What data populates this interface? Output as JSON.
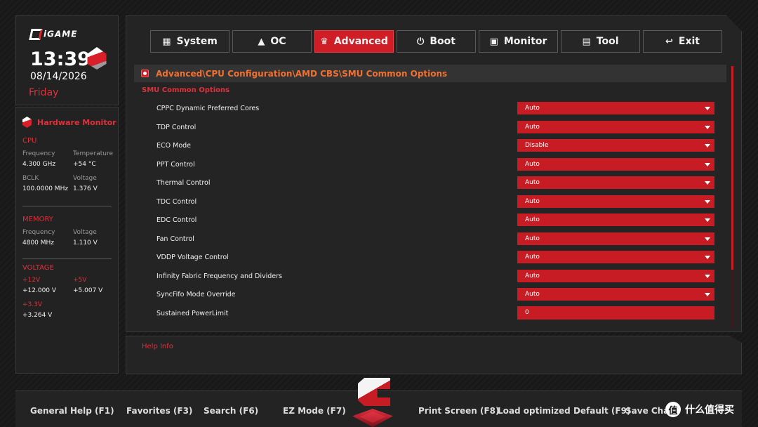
{
  "brand": {
    "logo_text": "iGAME"
  },
  "clock": {
    "time": "13:39",
    "date": "08/14/2026",
    "day": "Friday"
  },
  "hw": {
    "title": "Hardware Monitor",
    "cpu": {
      "section": "CPU",
      "freq_label": "Frequency",
      "freq_value": "4.300 GHz",
      "temp_label": "Temperature",
      "temp_value": "+54 °C",
      "bclk_label": "BCLK",
      "bclk_value": "100.0000 MHz",
      "volt_label": "Voltage",
      "volt_value": "1.376 V"
    },
    "memory": {
      "section": "MEMORY",
      "freq_label": "Frequency",
      "freq_value": "4800 MHz",
      "volt_label": "Voltage",
      "volt_value": "1.110 V"
    },
    "voltage": {
      "section": "VOLTAGE",
      "v12_label": "+12V",
      "v12_value": "+12.000 V",
      "v5_label": "+5V",
      "v5_value": "+5.007 V",
      "v33_label": "+3.3V",
      "v33_value": "+3.264 V"
    }
  },
  "tabs": [
    {
      "label": "System",
      "icon": "grid-icon"
    },
    {
      "label": "OC",
      "icon": "rocket-icon"
    },
    {
      "label": "Advanced",
      "icon": "crown-icon",
      "active": true
    },
    {
      "label": "Boot",
      "icon": "power-icon"
    },
    {
      "label": "Monitor",
      "icon": "monitor-icon"
    },
    {
      "label": "Tool",
      "icon": "toolbox-icon"
    },
    {
      "label": "Exit",
      "icon": "back-arrow-icon"
    }
  ],
  "breadcrumb": "Advanced\\CPU Configuration\\AMD CBS\\SMU Common Options",
  "section_title": "SMU Common Options",
  "options": [
    {
      "label": "CPPC Dynamic Preferred Cores",
      "value": "Auto"
    },
    {
      "label": "TDP Control",
      "value": "Auto"
    },
    {
      "label": "ECO Mode",
      "value": "Disable"
    },
    {
      "label": "PPT Control",
      "value": "Auto"
    },
    {
      "label": "Thermal Control",
      "value": "Auto"
    },
    {
      "label": "TDC Control",
      "value": "Auto"
    },
    {
      "label": "EDC Control",
      "value": "Auto"
    },
    {
      "label": "Fan Control",
      "value": "Auto"
    },
    {
      "label": "VDDP Voltage Control",
      "value": "Auto"
    },
    {
      "label": "Infinity Fabric Frequency and Dividers",
      "value": "Auto"
    },
    {
      "label": "SyncFifo Mode Override",
      "value": "Auto"
    },
    {
      "label": "Sustained PowerLimit",
      "value": "0"
    }
  ],
  "help": {
    "title": "Help Info"
  },
  "footer": {
    "general_help": "General Help (F1)",
    "favorites": "Favorites (F3)",
    "search": "Search (F6)",
    "ez_mode": "EZ Mode (F7)",
    "print_screen": "Print Screen (F8)",
    "load_default": "Load optimized Default (F9)",
    "save": "Save Chan"
  },
  "watermark": {
    "badge": "值",
    "text": "什么值得买"
  },
  "colors": {
    "accent": "#c81c24",
    "text_red": "#e0303a",
    "breadcrumb": "#f07030"
  }
}
